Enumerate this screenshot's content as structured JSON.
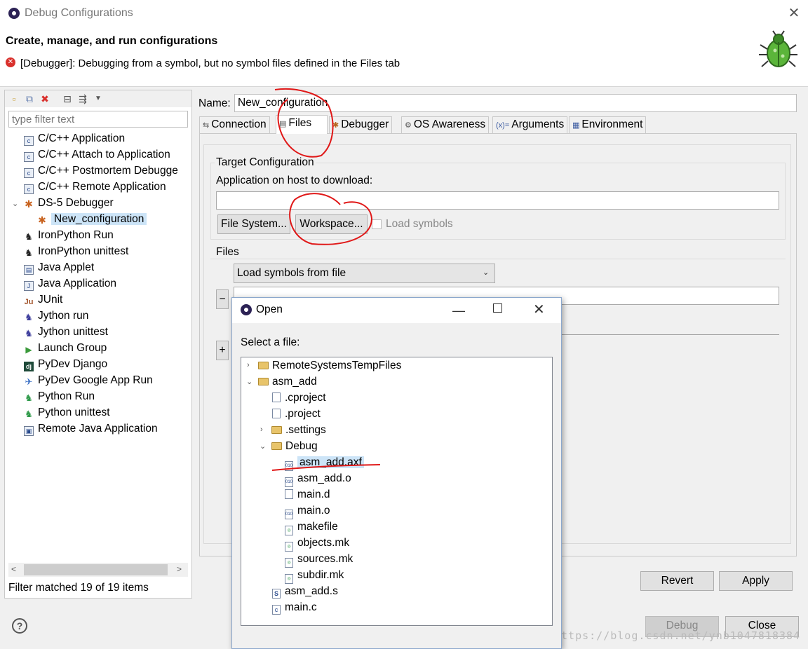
{
  "window": {
    "title": "Debug Configurations",
    "header_title": "Create, manage, and run configurations",
    "error_message": "[Debugger]: Debugging from a symbol, but no symbol files defined in the Files tab"
  },
  "left": {
    "filter_placeholder": "type filter text",
    "items": [
      {
        "label": "C/C++ Application",
        "icon": "c-app-icon"
      },
      {
        "label": "C/C++ Attach to Application",
        "icon": "c-attach-icon"
      },
      {
        "label": "C/C++ Postmortem Debugge",
        "icon": "c-postmortem-icon"
      },
      {
        "label": "C/C++ Remote Application",
        "icon": "c-remote-icon"
      },
      {
        "label": "DS-5 Debugger",
        "icon": "ds5-debugger-icon"
      },
      {
        "label": "New_configuration",
        "icon": "ds5-config-icon"
      },
      {
        "label": "IronPython Run",
        "icon": "ironpython-run-icon"
      },
      {
        "label": "IronPython unittest",
        "icon": "ironpython-unittest-icon"
      },
      {
        "label": "Java Applet",
        "icon": "java-applet-icon"
      },
      {
        "label": "Java Application",
        "icon": "java-app-icon"
      },
      {
        "label": "JUnit",
        "icon": "junit-icon"
      },
      {
        "label": "Jython run",
        "icon": "jython-run-icon"
      },
      {
        "label": "Jython unittest",
        "icon": "jython-unittest-icon"
      },
      {
        "label": "Launch Group",
        "icon": "launch-group-icon"
      },
      {
        "label": "PyDev Django",
        "icon": "django-icon"
      },
      {
        "label": "PyDev Google App Run",
        "icon": "google-app-icon"
      },
      {
        "label": "Python Run",
        "icon": "python-run-icon"
      },
      {
        "label": "Python unittest",
        "icon": "python-unittest-icon"
      },
      {
        "label": "Remote Java Application",
        "icon": "remote-java-icon"
      }
    ],
    "filter_status": "Filter matched 19 of 19 items"
  },
  "config": {
    "name_label": "Name:",
    "name_value": "New_configuration",
    "tabs": [
      "Connection",
      "Files",
      "Debugger",
      "OS Awareness",
      "Arguments",
      "Environment"
    ],
    "active_tab": "Files",
    "target_group": "Target Configuration",
    "app_label": "Application on host to download:",
    "app_value": "",
    "file_system_btn": "File System...",
    "workspace_btn": "Workspace...",
    "load_symbols": "Load symbols",
    "files_group": "Files",
    "symbols_select": "Load symbols from file",
    "minus": "−",
    "plus": "+",
    "revert": "Revert",
    "apply": "Apply",
    "debug": "Debug",
    "close": "Close"
  },
  "open_dialog": {
    "title": "Open",
    "prompt": "Select a file:",
    "tree": [
      "RemoteSystemsTempFiles",
      "asm_add",
      ".cproject",
      ".project",
      ".settings",
      "Debug",
      "asm_add.axf",
      "asm_add.o",
      "main.d",
      "main.o",
      "makefile",
      "objects.mk",
      "sources.mk",
      "subdir.mk",
      "asm_add.s",
      "main.c"
    ]
  },
  "watermark": "https://blog.csdn.net/ynb1047818384"
}
